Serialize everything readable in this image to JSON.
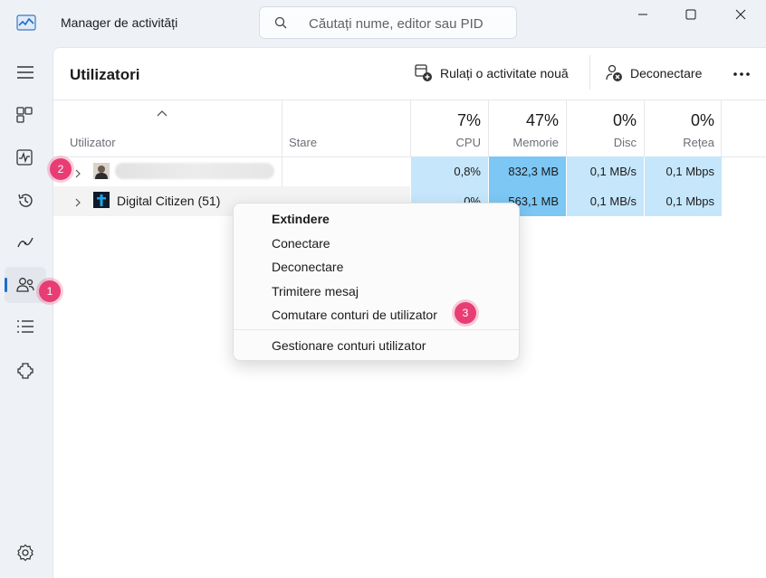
{
  "window": {
    "title": "Manager de activități",
    "search_placeholder": "Căutați nume, editor sau PID"
  },
  "sidebar": {
    "items": [
      {
        "name": "hamburger-menu",
        "icon": "menu-icon"
      },
      {
        "name": "processes",
        "icon": "processes-icon"
      },
      {
        "name": "performance",
        "icon": "performance-icon"
      },
      {
        "name": "app-history",
        "icon": "history-icon"
      },
      {
        "name": "startup-apps",
        "icon": "startup-icon"
      },
      {
        "name": "users",
        "icon": "users-icon",
        "active": true
      },
      {
        "name": "details",
        "icon": "details-icon"
      },
      {
        "name": "services",
        "icon": "services-icon"
      },
      {
        "name": "settings",
        "icon": "settings-icon"
      }
    ]
  },
  "page": {
    "title": "Utilizatori",
    "run_task_label": "Rulați o activitate nouă",
    "disconnect_label": "Deconectare",
    "more_label": "..."
  },
  "table": {
    "columns": {
      "user": "Utilizator",
      "status": "Stare",
      "cpu": {
        "pct": "7%",
        "label": "CPU"
      },
      "memory": {
        "pct": "47%",
        "label": "Memorie"
      },
      "disk": {
        "pct": "0%",
        "label": "Disc"
      },
      "network": {
        "pct": "0%",
        "label": "Rețea"
      }
    },
    "rows": [
      {
        "name": "",
        "cpu": "0,8%",
        "memory": "832,3 MB",
        "disk": "0,1 MB/s",
        "network": "0,1 Mbps"
      },
      {
        "name": "Digital Citizen (51)",
        "cpu": "0%",
        "memory": "563,1 MB",
        "disk": "0,1 MB/s",
        "network": "0,1 Mbps"
      }
    ]
  },
  "context_menu": {
    "items": [
      "Extindere",
      "Conectare",
      "Deconectare",
      "Trimitere mesaj",
      "Comutare conturi de utilizator",
      "Gestionare conturi utilizator"
    ]
  },
  "badges": [
    "1",
    "2",
    "3"
  ],
  "colors": {
    "cpu_cell": "#c6e6fb",
    "memory_cell": "#7cc7f4",
    "accent": "#1b6fc9",
    "badge": "#e83d74"
  }
}
